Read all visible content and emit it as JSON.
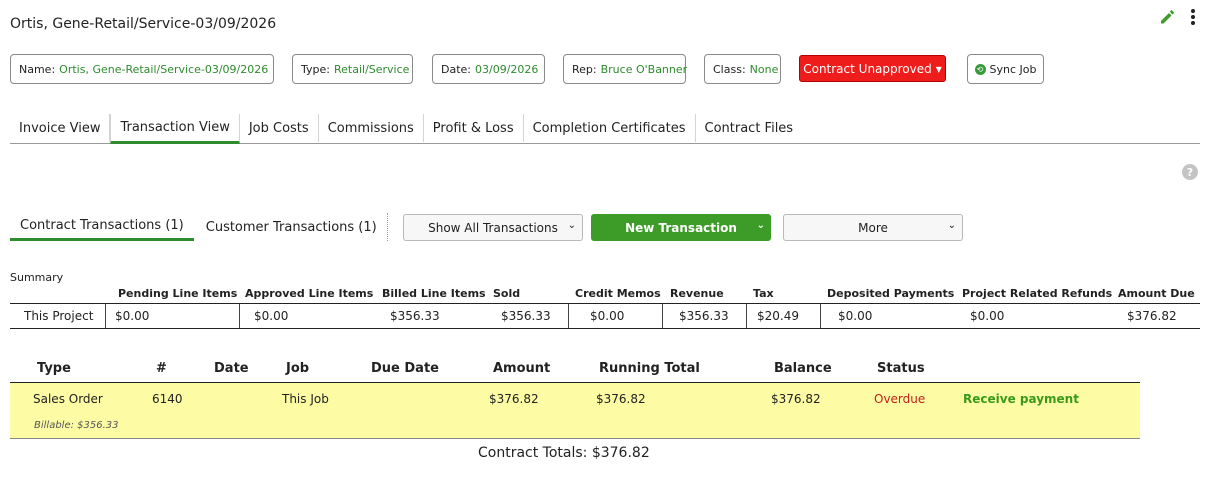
{
  "page": {
    "title": "Ortis, Gene-Retail/Service-03/09/2026"
  },
  "top_icons": {
    "edit": "pencil-icon",
    "menu": "kebab-menu-icon"
  },
  "info": {
    "name_label": "Name:",
    "name_value": "Ortis, Gene-Retail/Service-03/09/2026",
    "type_label": "Type:",
    "type_value": "Retail/Service",
    "date_label": "Date:",
    "date_value": "03/09/2026",
    "rep_label": "Rep:",
    "rep_value": "Bruce O'Banner",
    "class_label": "Class:",
    "class_value": "None"
  },
  "contract_status": {
    "label": "Contract Unapproved",
    "chevron": "▾"
  },
  "sync": {
    "label": "Sync Job"
  },
  "tabs": [
    {
      "label": "Invoice View"
    },
    {
      "label": "Transaction View"
    },
    {
      "label": "Job Costs"
    },
    {
      "label": "Commissions"
    },
    {
      "label": "Profit & Loss"
    },
    {
      "label": "Completion Certificates"
    },
    {
      "label": "Contract Files"
    }
  ],
  "help": {
    "glyph": "?"
  },
  "sub_tabs": [
    {
      "label": "Contract Transactions (1)"
    },
    {
      "label": "Customer Transactions (1)"
    }
  ],
  "controls": {
    "filter_value": "Show All Transactions",
    "new_transaction": "New Transaction",
    "more": "More",
    "chevron": "⌄"
  },
  "summary": {
    "label": "Summary",
    "headers": [
      "Pending Line Items",
      "Approved Line Items",
      "Billed Line Items",
      "Sold",
      "Credit Memos",
      "Revenue",
      "Tax",
      "Deposited Payments",
      "Project Related Refunds",
      "Amount Due"
    ],
    "row": {
      "name": "This Project",
      "values": [
        "$0.00",
        "$0.00",
        "$356.33",
        "$356.33",
        "$0.00",
        "$356.33",
        "$20.49",
        "$0.00",
        "$0.00",
        "$376.82"
      ]
    }
  },
  "transactions": {
    "headers": [
      "Type",
      "#",
      "Date",
      "Job",
      "Due Date",
      "Amount",
      "Running Total",
      "Balance",
      "Status"
    ],
    "rows": [
      {
        "type": "Sales Order",
        "number": "6140",
        "date": "",
        "job": "This Job",
        "due_date": "",
        "amount": "$376.82",
        "running_total": "$376.82",
        "balance": "$376.82",
        "status": "Overdue",
        "action": "Receive payment",
        "billable": "Billable: $356.33"
      }
    ]
  },
  "totals": {
    "label": "Contract Totals: $376.82"
  },
  "colors": {
    "accent": "#2e8b2e",
    "danger": "#ef1c1c",
    "highlight": "#fdfca5"
  }
}
